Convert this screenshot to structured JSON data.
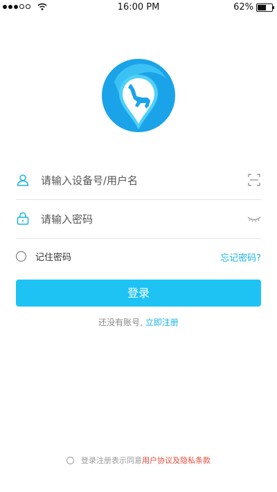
{
  "status_bar": {
    "time": "16:00 PM",
    "battery": "62%",
    "battery_level": 0.62,
    "signal_bars": 3,
    "signal_total": 5
  },
  "logo": {
    "icon": "dog-location-pin-icon",
    "colors": {
      "outer": "#1aa3e8",
      "inner": "#4fd0f7",
      "pin": "#ffffff"
    }
  },
  "form": {
    "username_placeholder": "请输入设备号/用户名",
    "password_placeholder": "请输入密码",
    "remember_label": "记住密码",
    "forgot_label": "忘记密码?",
    "login_label": "登录"
  },
  "register": {
    "prompt": "还没有账号,",
    "link": "立即注册"
  },
  "agreement": {
    "prefix": "登录注册表示同意",
    "link": "用户协议及隐私条款"
  },
  "colors": {
    "accent": "#1ec3f3",
    "link": "#19b4e6",
    "agreement_link": "#e04b3b"
  }
}
